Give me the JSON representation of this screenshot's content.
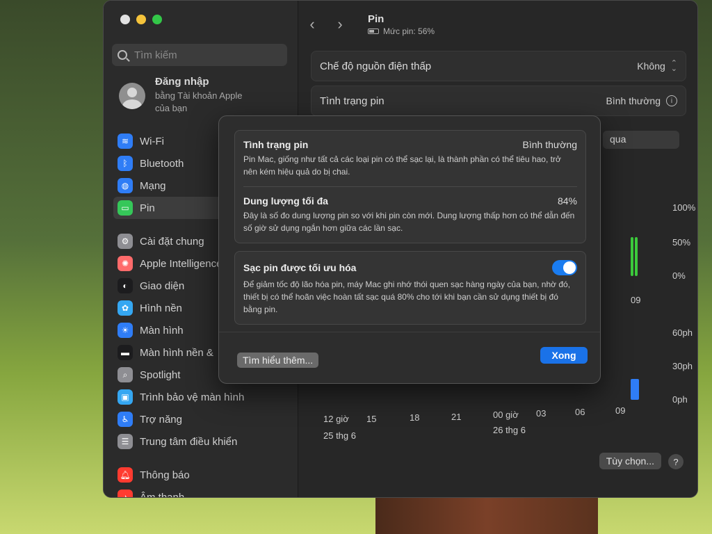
{
  "sidebar": {
    "search_placeholder": "Tìm kiếm",
    "account": {
      "title": "Đăng nhập",
      "subtitle_line1": "bằng Tài khoản Apple",
      "subtitle_line2": "của bạn"
    },
    "items": [
      {
        "label": "Wi-Fi",
        "icon": "wifi-icon",
        "color": "#2f7df6"
      },
      {
        "label": "Bluetooth",
        "icon": "bluetooth-icon",
        "color": "#2f7df6"
      },
      {
        "label": "Mạng",
        "icon": "globe-icon",
        "color": "#2f7df6"
      },
      {
        "label": "Pin",
        "icon": "battery-icon",
        "color": "#35c759"
      },
      {
        "label": "Cài đặt chung",
        "icon": "gear-icon",
        "color": "#8e8e93"
      },
      {
        "label": "Apple Intelligence",
        "icon": "apple-intelligence-icon",
        "color": "#ff6b6b"
      },
      {
        "label": "Giao diện",
        "icon": "appearance-icon",
        "color": "#1c1c1e"
      },
      {
        "label": "Hình nền",
        "icon": "wallpaper-icon",
        "color": "#35a7f2"
      },
      {
        "label": "Màn hình",
        "icon": "display-icon",
        "color": "#2f7df6"
      },
      {
        "label": "Màn hình nền &",
        "icon": "desktop-dock-icon",
        "color": "#1c1c1e"
      },
      {
        "label": "Spotlight",
        "icon": "spotlight-icon",
        "color": "#8e8e93"
      },
      {
        "label": "Trình bảo vệ màn hình",
        "icon": "screensaver-icon",
        "color": "#35a7f2"
      },
      {
        "label": "Trợ năng",
        "icon": "accessibility-icon",
        "color": "#2f7df6"
      },
      {
        "label": "Trung tâm điều khiển",
        "icon": "control-center-icon",
        "color": "#8e8e93"
      },
      {
        "label": "Thông báo",
        "icon": "notifications-icon",
        "color": "#ff3b30"
      },
      {
        "label": "Âm thanh",
        "icon": "sound-icon",
        "color": "#ff3b30"
      }
    ]
  },
  "header": {
    "title": "Pin",
    "battery_level": "Mức pin: 56%"
  },
  "settings": {
    "low_power_label": "Chế độ nguồn điện thấp",
    "low_power_value": "Không",
    "battery_health_label": "Tình trạng pin",
    "battery_health_value": "Bình thường",
    "range_tab": "qua"
  },
  "chart_data": {
    "type": "bar",
    "y_percent_ticks": [
      "100%",
      "50%",
      "0%"
    ],
    "y_time_ticks": [
      "60ph",
      "30ph",
      "0ph"
    ],
    "x_ticks": [
      "12 giờ",
      "15",
      "18",
      "21",
      "00 giờ",
      "03",
      "06",
      "09"
    ],
    "top_chart_label": "09",
    "date_labels": [
      "25 thg 6",
      "26 thg 6"
    ],
    "battery_bar_color": "#3cc93c",
    "usage_bar_color": "#2f7df6"
  },
  "footer": {
    "customize": "Tùy chọn...",
    "help": "?"
  },
  "modal": {
    "health_title": "Tình trạng pin",
    "health_value": "Bình thường",
    "health_desc": "Pin Mac, giống như tất cả các loại pin có thể sạc lại, là thành phần có thể tiêu hao, trở nên kém hiệu quả do bị chai.",
    "capacity_title": "Dung lượng tối đa",
    "capacity_value": "84%",
    "capacity_desc": "Đây là số đo dung lượng pin so với khi pin còn mới. Dung lượng thấp hơn có thể dẫn đến số giờ sử dụng ngắn hơn giữa các lần sạc.",
    "optimized_title": "Sạc pin được tối ưu hóa",
    "optimized_on": true,
    "optimized_desc": "Để giảm tốc độ lão hóa pin, máy Mac ghi nhớ thói quen sạc hàng ngày của bạn, nhờ đó, thiết bị có thể hoãn việc hoàn tất sạc quá 80% cho tới khi bạn cần sử dụng thiết bị đó bằng pin.",
    "learn_more": "Tìm hiểu thêm...",
    "done": "Xong"
  }
}
